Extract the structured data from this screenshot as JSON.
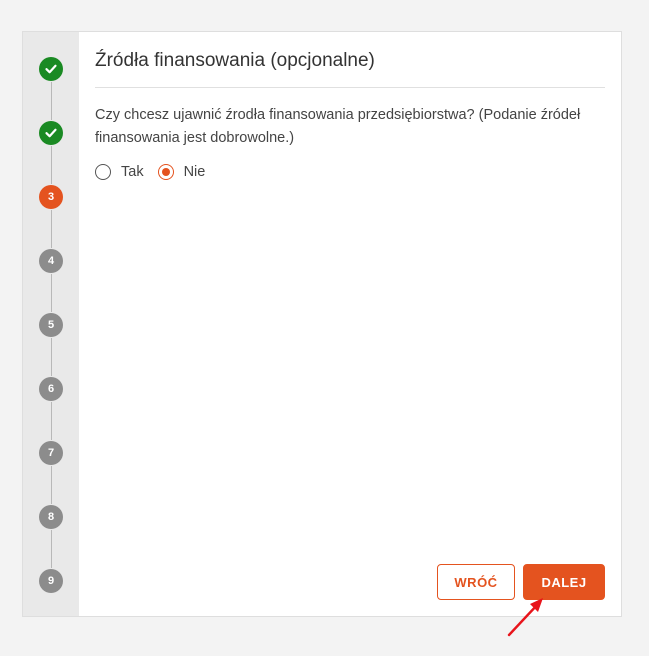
{
  "stepper": {
    "steps": [
      {
        "label": "",
        "state": "done",
        "icon": "check-icon"
      },
      {
        "label": "",
        "state": "done",
        "icon": "check-icon"
      },
      {
        "label": "3",
        "state": "current"
      },
      {
        "label": "4",
        "state": "pending"
      },
      {
        "label": "5",
        "state": "pending"
      },
      {
        "label": "6",
        "state": "pending"
      },
      {
        "label": "7",
        "state": "pending"
      },
      {
        "label": "8",
        "state": "pending"
      },
      {
        "label": "9",
        "state": "pending"
      }
    ]
  },
  "form": {
    "title": "Źródła finansowania (opcjonalne)",
    "question": "Czy chcesz ujawnić źrodła finansowania przedsiębiorstwa? (Podanie źródeł finansowania jest dobrowolne.)",
    "options": [
      {
        "label": "Tak",
        "selected": false
      },
      {
        "label": "Nie",
        "selected": true
      }
    ]
  },
  "actions": {
    "back_label": "WRÓĆ",
    "next_label": "DALEJ"
  },
  "colors": {
    "accent": "#e4531f",
    "done": "#1a8a23",
    "pending": "#8c8c8c",
    "annotation_arrow": "#e8141b"
  }
}
